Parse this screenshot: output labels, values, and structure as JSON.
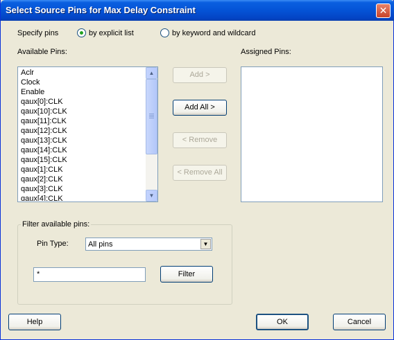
{
  "window": {
    "title": "Select Source Pins for Max Delay Constraint",
    "close_icon": "close-icon"
  },
  "specify": {
    "label": "Specify pins",
    "options": [
      {
        "label": "by explicit list",
        "checked": true
      },
      {
        "label": "by keyword and wildcard",
        "checked": false
      }
    ]
  },
  "available": {
    "label": "Available Pins:",
    "items": [
      "Aclr",
      "Clock",
      "Enable",
      "qaux[0]:CLK",
      "qaux[10]:CLK",
      "qaux[11]:CLK",
      "qaux[12]:CLK",
      "qaux[13]:CLK",
      "qaux[14]:CLK",
      "qaux[15]:CLK",
      "qaux[1]:CLK",
      "qaux[2]:CLK",
      "qaux[3]:CLK",
      "qaux[4]:CLK"
    ]
  },
  "assigned": {
    "label": "Assigned Pins:",
    "items": []
  },
  "actions": {
    "add": "Add >",
    "add_all": "Add All >",
    "remove": "< Remove",
    "remove_all": "< Remove All"
  },
  "filter": {
    "group_label": "Filter available pins:",
    "pin_type_label": "Pin Type:",
    "pin_type_value": "All pins",
    "pattern_value": "*",
    "filter_button": "Filter"
  },
  "footer": {
    "help": "Help",
    "ok": "OK",
    "cancel": "Cancel"
  }
}
